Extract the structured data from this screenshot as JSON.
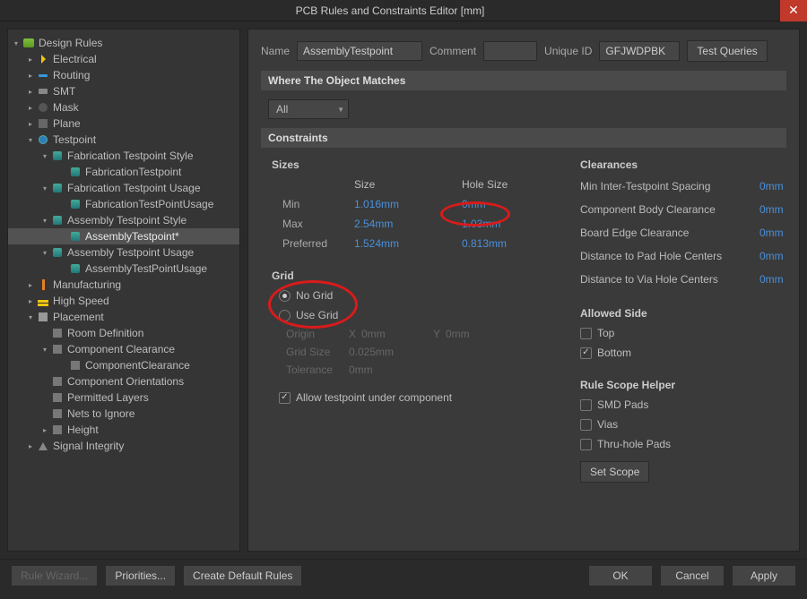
{
  "title": "PCB Rules and Constraints Editor [mm]",
  "tree": {
    "root": "Design Rules",
    "electrical": "Electrical",
    "routing": "Routing",
    "smt": "SMT",
    "mask": "Mask",
    "plane": "Plane",
    "testpoint": "Testpoint",
    "fab_style": "Fabrication Testpoint Style",
    "fab_style_rule": "FabricationTestpoint",
    "fab_usage": "Fabrication Testpoint Usage",
    "fab_usage_rule": "FabricationTestPointUsage",
    "asm_style": "Assembly Testpoint Style",
    "asm_style_rule": "AssemblyTestpoint*",
    "asm_usage": "Assembly Testpoint Usage",
    "asm_usage_rule": "AssemblyTestPointUsage",
    "mfg": "Manufacturing",
    "hs": "High Speed",
    "placement": "Placement",
    "room": "Room Definition",
    "comp_clr": "Component Clearance",
    "comp_clr_rule": "ComponentClearance",
    "comp_orient": "Component Orientations",
    "perm_layers": "Permitted Layers",
    "nets_ignore": "Nets to Ignore",
    "height": "Height",
    "si": "Signal Integrity"
  },
  "top": {
    "name_label": "Name",
    "name_value": "AssemblyTestpoint",
    "comment_label": "Comment",
    "comment_value": "",
    "uid_label": "Unique ID",
    "uid_value": "GFJWDPBK",
    "test_queries": "Test Queries"
  },
  "section": {
    "where": "Where The Object Matches",
    "all": "All",
    "constraints": "Constraints"
  },
  "sizes": {
    "header": "Sizes",
    "col_size": "Size",
    "col_hole": "Hole Size",
    "min": "Min",
    "min_size": "1.016mm",
    "min_hole": "0mm",
    "max": "Max",
    "max_size": "2.54mm",
    "max_hole": "1.03mm",
    "pref": "Preferred",
    "pref_size": "1.524mm",
    "pref_hole": "0.813mm"
  },
  "clearances": {
    "header": "Clearances",
    "intertp": "Min Inter-Testpoint Spacing",
    "intertp_v": "0mm",
    "body": "Component Body Clearance",
    "body_v": "0mm",
    "edge": "Board Edge Clearance",
    "edge_v": "0mm",
    "pad": "Distance to Pad Hole Centers",
    "pad_v": "0mm",
    "via": "Distance to Via Hole Centers",
    "via_v": "0mm"
  },
  "grid": {
    "header": "Grid",
    "no_grid": "No Grid",
    "use_grid": "Use Grid",
    "origin": "Origin",
    "x": "X",
    "ox": "0mm",
    "y": "Y",
    "oy": "0mm",
    "size": "Grid Size",
    "size_v": "0.025mm",
    "tol": "Tolerance",
    "tol_v": "0mm",
    "allow": "Allow testpoint under component"
  },
  "side": {
    "header": "Allowed Side",
    "top": "Top",
    "bottom": "Bottom"
  },
  "scope": {
    "header": "Rule Scope Helper",
    "smd": "SMD Pads",
    "vias": "Vias",
    "thru": "Thru-hole Pads",
    "set": "Set Scope"
  },
  "footer": {
    "wizard": "Rule Wizard...",
    "priorities": "Priorities...",
    "defaults": "Create Default Rules",
    "ok": "OK",
    "cancel": "Cancel",
    "apply": "Apply"
  }
}
